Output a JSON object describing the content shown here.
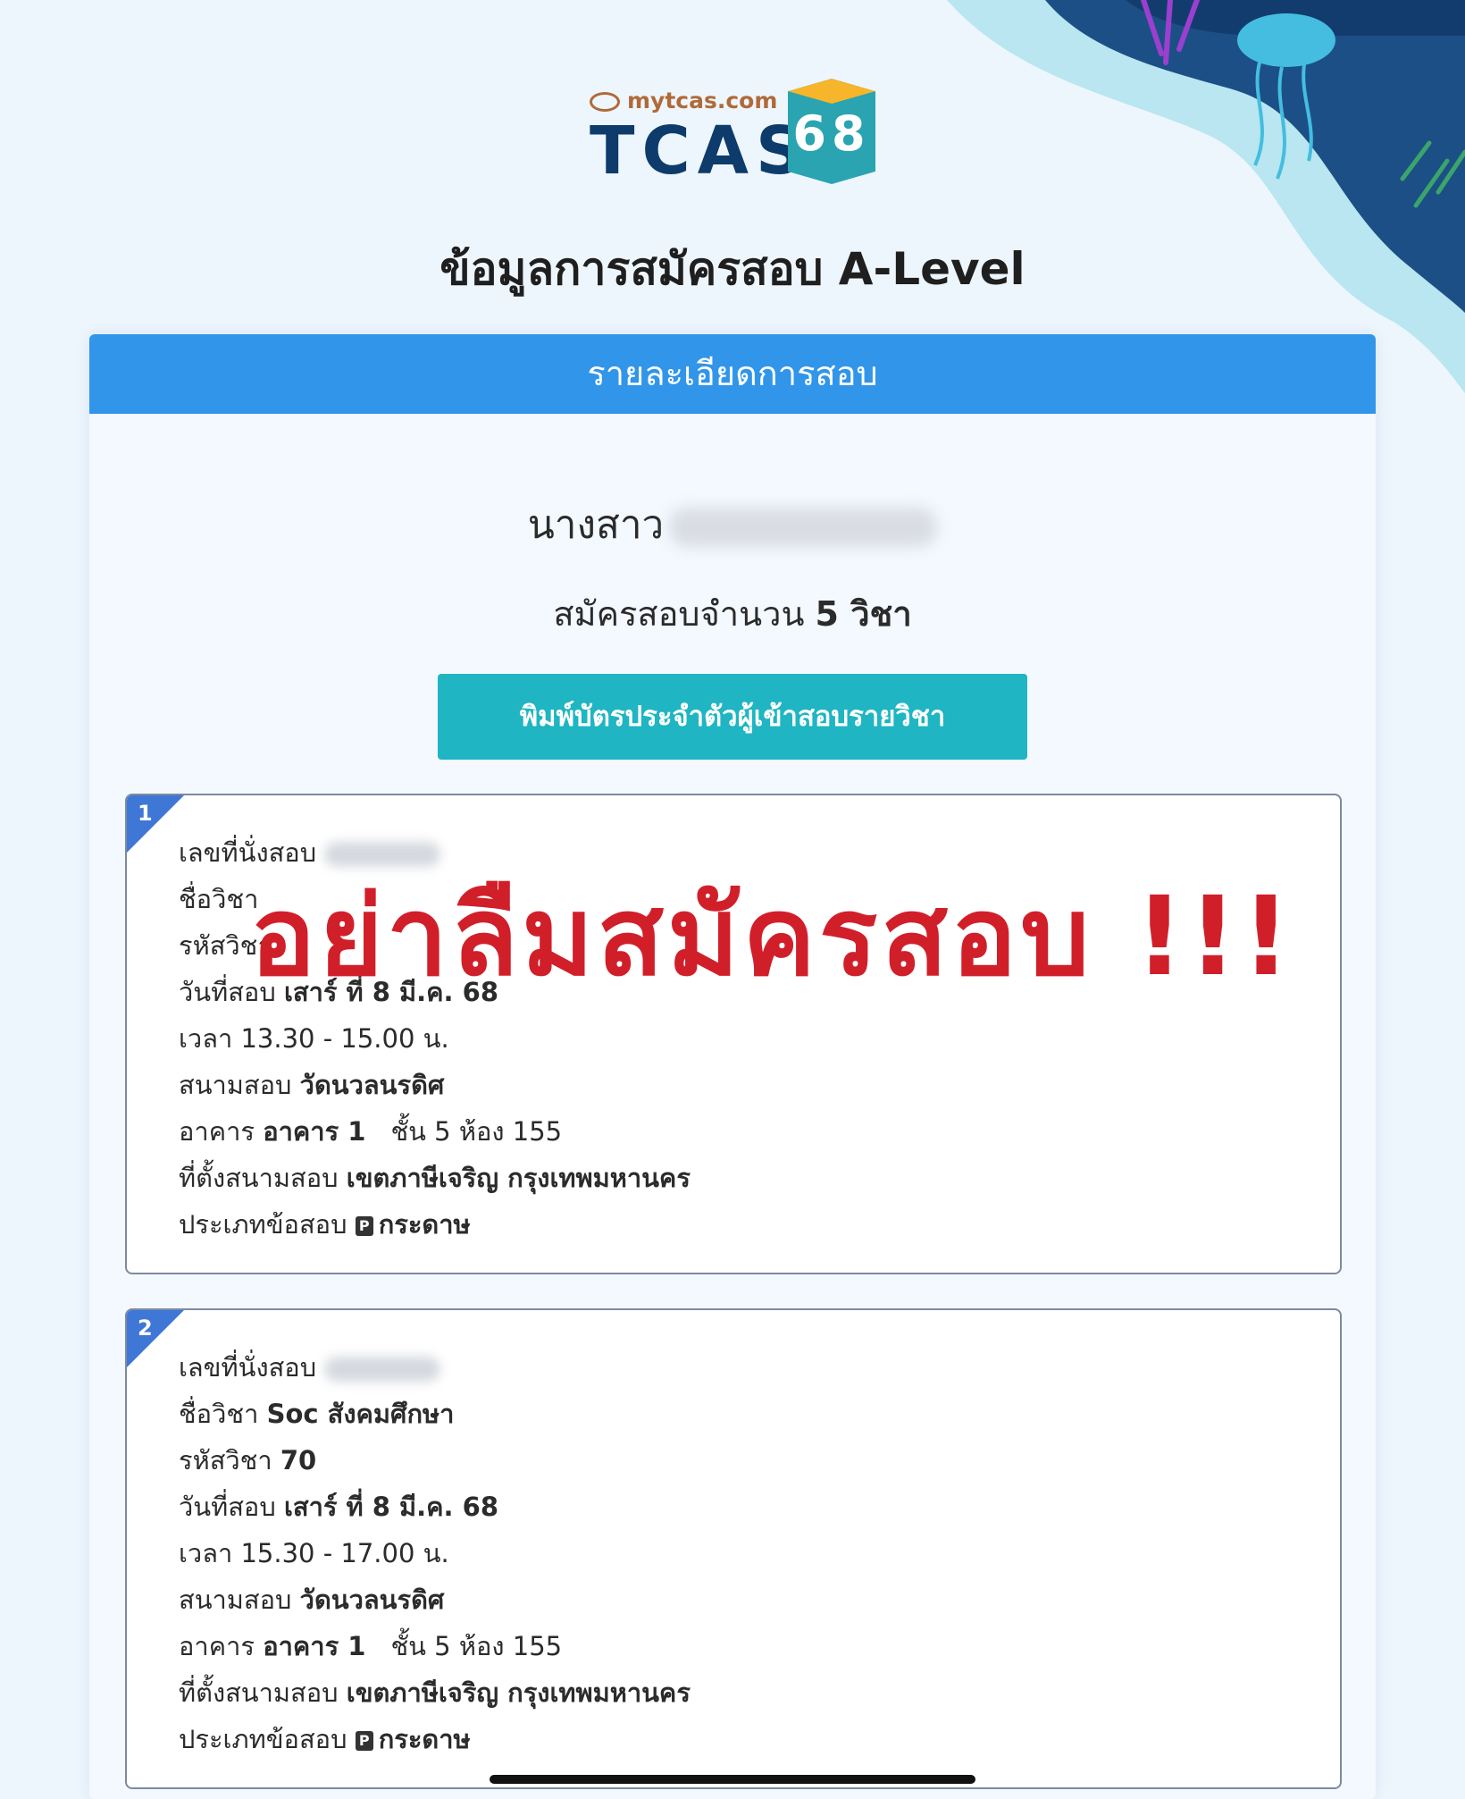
{
  "logo": {
    "site": "mytcas.com",
    "brand": "TCAS",
    "year": "68"
  },
  "page_title": "ข้อมูลการสมัครสอบ A-Level",
  "panel": {
    "header": "รายละเอียดการสอบ",
    "name_prefix": "นางสาว",
    "count_prefix": "สมัครสอบจำนวน",
    "count_value": "5 วิชา",
    "print_button": "พิมพ์บัตรประจำตัวผู้เข้าสอบรายวิชา"
  },
  "overlay_text": "อย่าลืมสมัครสอบ !!!",
  "cards": [
    {
      "number": "1",
      "seat_label": "เลขที่นั่งสอบ",
      "subject_label": "ชื่อวิชา",
      "subject_value": "",
      "code_label": "รหัสวิชา",
      "code_value": "",
      "date_label": "วันที่สอบ",
      "date_value": "เสาร์ ที่ 8 มี.ค. 68",
      "time_label": "เวลา",
      "time_value": "13.30 - 15.00 น.",
      "venue_label": "สนามสอบ",
      "venue_value": "วัดนวลนรดิศ",
      "building_label": "อาคาร",
      "building_value": "อาคาร 1",
      "room_value": "ชั้น 5 ห้อง 155",
      "location_label": "ที่ตั้งสนามสอบ",
      "location_value": "เขตภาษีเจริญ กรุงเทพมหานคร",
      "type_label": "ประเภทข้อสอบ",
      "type_icon": "P",
      "type_value": "กระดาษ"
    },
    {
      "number": "2",
      "seat_label": "เลขที่นั่งสอบ",
      "subject_label": "ชื่อวิชา",
      "subject_value": "Soc สังคมศึกษา",
      "code_label": "รหัสวิชา",
      "code_value": "70",
      "date_label": "วันที่สอบ",
      "date_value": "เสาร์ ที่ 8 มี.ค. 68",
      "time_label": "เวลา",
      "time_value": "15.30 - 17.00 น.",
      "venue_label": "สนามสอบ",
      "venue_value": "วัดนวลนรดิศ",
      "building_label": "อาคาร",
      "building_value": "อาคาร 1",
      "room_value": "ชั้น 5 ห้อง 155",
      "location_label": "ที่ตั้งสนามสอบ",
      "location_value": "เขตภาษีเจริญ กรุงเทพมหานคร",
      "type_label": "ประเภทข้อสอบ",
      "type_icon": "P",
      "type_value": "กระดาษ"
    }
  ]
}
